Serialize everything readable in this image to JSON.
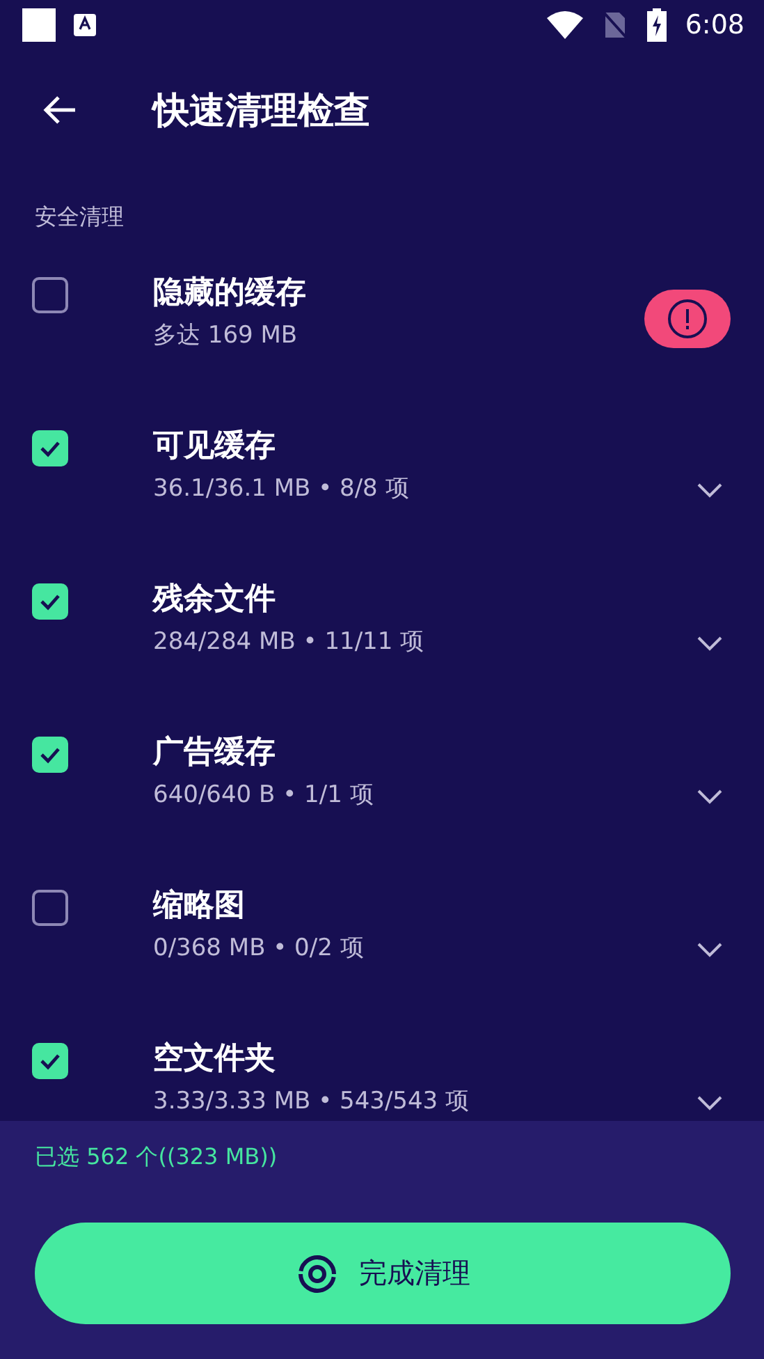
{
  "status_bar": {
    "time": "6:08"
  },
  "header": {
    "title": "快速清理检查"
  },
  "section": {
    "label": "安全清理"
  },
  "items": [
    {
      "title": "隐藏的缓存",
      "detail": "多达 169 MB",
      "checked": false,
      "kind": "alert"
    },
    {
      "title": "可见缓存",
      "detail": "36.1/36.1 MB • 8/8 项",
      "checked": true,
      "kind": "expand"
    },
    {
      "title": "残余文件",
      "detail": "284/284 MB • 11/11 项",
      "checked": true,
      "kind": "expand"
    },
    {
      "title": "广告缓存",
      "detail": "640/640 B • 1/1 项",
      "checked": true,
      "kind": "expand"
    },
    {
      "title": "缩略图",
      "detail": "0/368 MB • 0/2 项",
      "checked": false,
      "kind": "expand"
    },
    {
      "title": "空文件夹",
      "detail": "3.33/3.33 MB • 543/543 项",
      "checked": true,
      "kind": "expand"
    }
  ],
  "footer": {
    "summary": "已选 562 个((323 MB))",
    "button": "完成清理"
  }
}
